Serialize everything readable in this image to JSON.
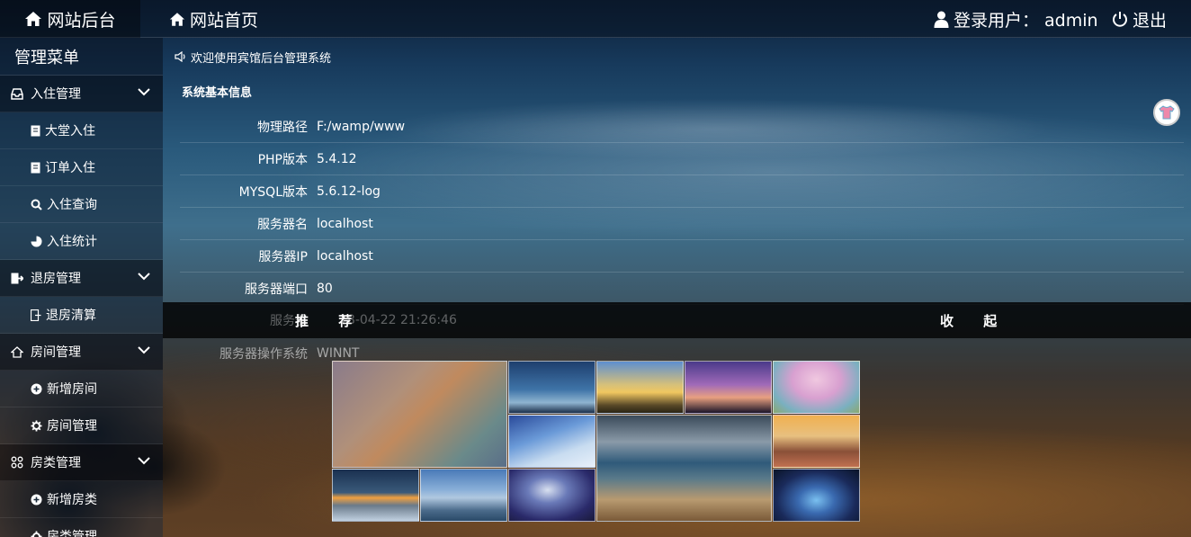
{
  "topbar": {
    "brand": "网站后台",
    "home": "网站首页",
    "user": "登录用户： admin",
    "logout": "退出"
  },
  "sidebar": {
    "title": "管理菜单",
    "groups": [
      {
        "label": "入住管理",
        "items": [
          "大堂入住",
          "订单入住",
          "入住查询",
          "入住统计"
        ]
      },
      {
        "label": "退房管理",
        "items": [
          "退房清算"
        ]
      },
      {
        "label": "房间管理",
        "items": [
          "新增房间",
          "房间管理"
        ]
      },
      {
        "label": "房类管理",
        "items": [
          "新增房类",
          "房类管理"
        ]
      }
    ]
  },
  "notice": "欢迎使用宾馆后台管理系统",
  "section_title": "系统基本信息",
  "info": [
    {
      "k": "物理路径",
      "v": "F:/wamp/www"
    },
    {
      "k": "PHP版本",
      "v": "5.4.12"
    },
    {
      "k": "MYSQL版本",
      "v": "5.6.12-log"
    },
    {
      "k": "服务器名",
      "v": "localhost"
    },
    {
      "k": "服务器IP",
      "v": "localhost"
    },
    {
      "k": "服务器端口",
      "v": "80"
    }
  ],
  "time_row": {
    "k": "服务器",
    "v": "18-04-22 21:26:46"
  },
  "os_row": {
    "k": "服务器操作系统",
    "v": "WINNT"
  },
  "overlay": {
    "recommend": "推 荐",
    "collapse": "收 起"
  }
}
